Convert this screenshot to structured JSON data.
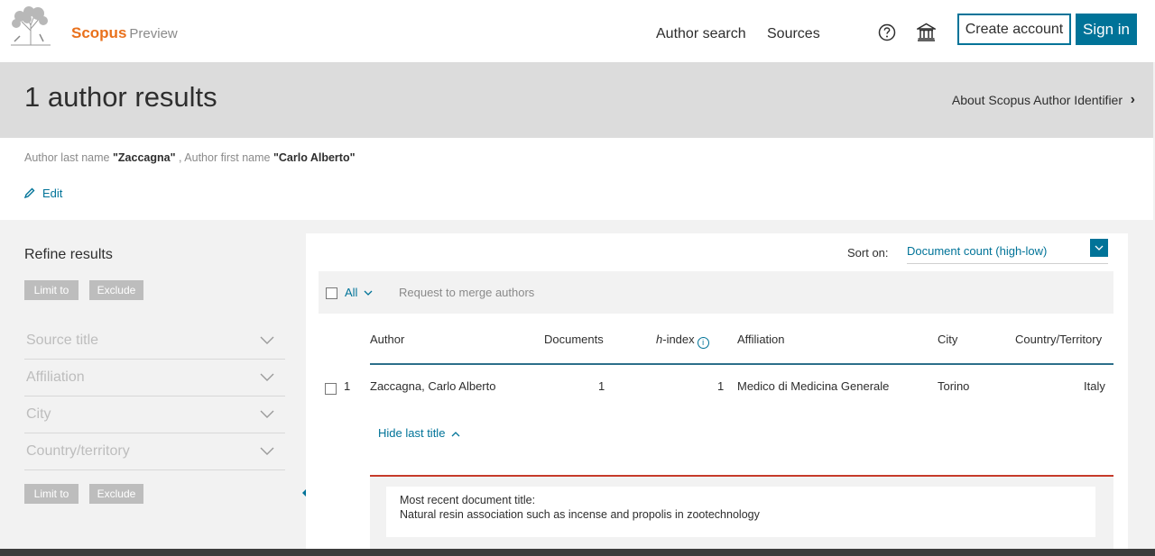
{
  "header": {
    "brand_name": "Scopus",
    "brand_suffix": "Preview",
    "nav_author_search": "Author search",
    "nav_sources": "Sources",
    "help_icon": "question-circle-icon",
    "institution_icon": "institution-icon",
    "create_account": "Create account",
    "sign_in": "Sign in",
    "accent_color": "#007398",
    "brand_color": "#e9711c"
  },
  "titlebar": {
    "title": "1 author results",
    "about_link": "About Scopus Author Identifier",
    "about_chevron": "›"
  },
  "query": {
    "last_name_label": "Author last name",
    "last_name_value": "\"Zaccagna\"",
    "separator": ",",
    "first_name_label": "Author first name",
    "first_name_value": "\"Carlo Alberto\"",
    "edit_label": "Edit"
  },
  "refine": {
    "title": "Refine results",
    "limit_to": "Limit to",
    "exclude": "Exclude",
    "facets": [
      {
        "label": "Source title"
      },
      {
        "label": "Affiliation"
      },
      {
        "label": "City"
      },
      {
        "label": "Country/territory"
      }
    ]
  },
  "results": {
    "sort_label": "Sort on:",
    "sort_value": "Document count (high-low)",
    "all_label": "All",
    "merge_label": "Request to merge authors",
    "columns": {
      "author": "Author",
      "documents": "Documents",
      "h_index_prefix": "h",
      "h_index_suffix": "-index",
      "affiliation": "Affiliation",
      "city": "City",
      "country": "Country/Territory"
    },
    "rows": [
      {
        "index": "1",
        "author": "Zaccagna, Carlo Alberto",
        "documents": "1",
        "h_index": "1",
        "affiliation": "Medico di Medicina Generale",
        "city": "Torino",
        "country": "Italy"
      }
    ],
    "hide_last_title": "Hide last title",
    "recent_title_label": "Most recent document title:",
    "recent_title_value": "Natural resin association such as incense and propolis in zootechnology"
  }
}
